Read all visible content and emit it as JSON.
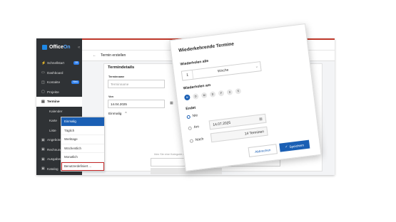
{
  "app": {
    "logo_prefix": "Office",
    "logo_suffix": "On",
    "collapse": "«"
  },
  "sidebar": {
    "items": [
      {
        "label": "Schnellstart",
        "icon": "⚡",
        "badge": "15"
      },
      {
        "label": "Dashboard",
        "icon": "▭"
      },
      {
        "label": "Kontakte",
        "icon": "◫",
        "badge": "Neu"
      },
      {
        "label": "Projekte",
        "icon": "▢"
      },
      {
        "label": "Termine",
        "icon": "▤"
      },
      {
        "label": "Kalender"
      },
      {
        "label": "Karte"
      },
      {
        "label": "Liste"
      },
      {
        "label": "Angebote",
        "icon": "▣"
      },
      {
        "label": "Rechnungen",
        "icon": "▣"
      },
      {
        "label": "Ausgaben",
        "icon": "▣"
      },
      {
        "label": "Katalog",
        "icon": "▣"
      }
    ]
  },
  "header": {
    "back": "←",
    "title": "Termin erstellen"
  },
  "form": {
    "section_title": "Termindetails",
    "name_label": "Terminname",
    "name_placeholder": "Terminname",
    "start_label": "Von",
    "start_date": "14.04.2025",
    "repeat_value": "Einmalig",
    "chevron": "⌃",
    "hint_text": "hlen Sie eine Kategorie auf dem Anzeichnen",
    "dropdown_options": [
      "Einmalig",
      "Täglich",
      "Werktage",
      "Wöchentlich",
      "Monatlich",
      "Benutzerdefiniert ..."
    ]
  },
  "dialog": {
    "title": "Wiederkehrende Termine",
    "repeat_every_label": "Wiederholen alle",
    "interval_value": "1",
    "unit_value": "Woche",
    "repeat_on_label": "Wiederholen am",
    "days": [
      "M",
      "D",
      "M",
      "D",
      "F",
      "S",
      "S"
    ],
    "ends_label": "Endet",
    "end_never": "Nie",
    "end_on": "Am",
    "end_on_date": "14.07.2025",
    "end_after": "Nach",
    "end_after_value": "14 Terminen",
    "cancel": "Abbrechen",
    "save": "Speichern",
    "save_check": "✓"
  }
}
